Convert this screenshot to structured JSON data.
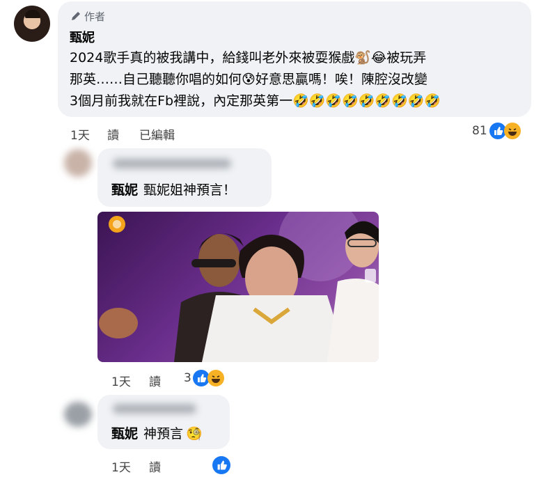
{
  "post": {
    "author_badge": "作者",
    "author_name": "甄妮",
    "lines": [
      "2024歌手真的被我講中，給錢叫老外來被耍猴戲",
      "被玩弄",
      "那英……自己聽聽你唱的如何",
      "好意思贏嗎！唉！陳腔沒改變",
      "3個月前我就在Fb裡說，內定那英第一"
    ],
    "time": "1天",
    "read": "讀",
    "edited": "已編輯",
    "reaction_count": "81"
  },
  "reply1": {
    "tag": "甄妮",
    "text": "甄妮姐神預言！",
    "time": "1天",
    "read": "讀",
    "reaction_count": "3"
  },
  "reply2": {
    "tag": "甄妮",
    "text": "神預言",
    "time": "1天",
    "read": "讀"
  },
  "colors": {
    "like_blue": "#1877f2",
    "haha_yellow": "#f7b125",
    "bubble_bg": "#f0f2f5",
    "video_purple": "#6a2e8c"
  },
  "icons": [
    "pencil-icon",
    "monkey-emoji",
    "laugh-tears-emoji",
    "anxious-sweat-emoji",
    "rofl-emoji",
    "like-icon",
    "haha-icon",
    "thinking-monocle-emoji"
  ]
}
